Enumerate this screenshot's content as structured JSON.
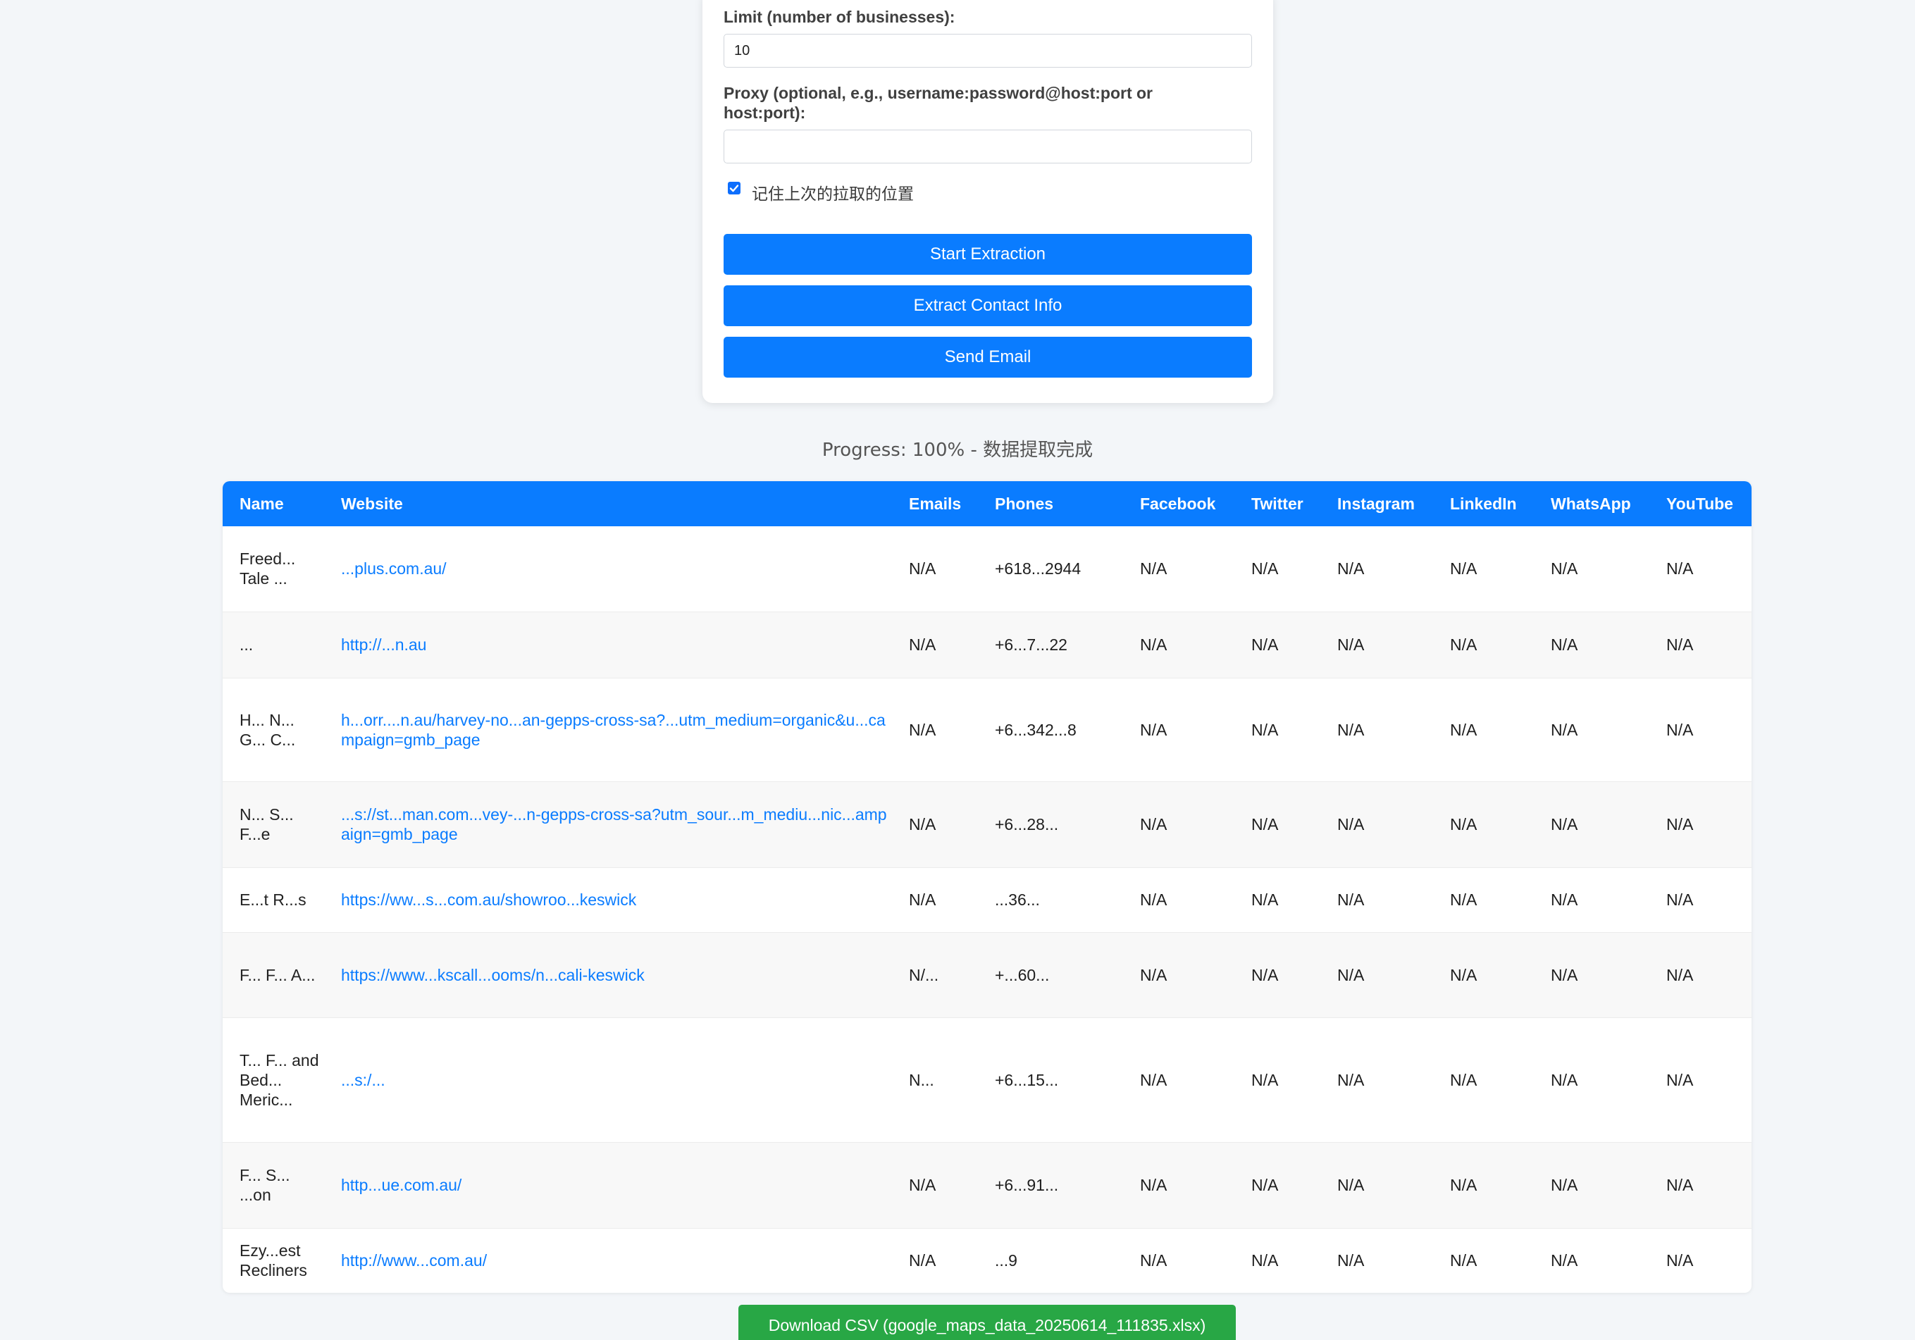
{
  "form": {
    "limit_label": "Limit (number of businesses):",
    "limit_value": "10",
    "proxy_label": "Proxy (optional, e.g., username:password@host:port or host:port):",
    "proxy_value": "",
    "remember_checked": true,
    "remember_label": "记住上次的拉取的位置",
    "start_button": "Start Extraction",
    "extract_button": "Extract Contact Info",
    "email_button": "Send Email"
  },
  "progress": {
    "text": "Progress: 100% - 数据提取完成",
    "percent": 100
  },
  "table": {
    "headers": [
      "Name",
      "Website",
      "Emails",
      "Phones",
      "Facebook",
      "Twitter",
      "Instagram",
      "LinkedIn",
      "WhatsApp",
      "YouTube"
    ],
    "rows": [
      {
        "name": "Freed... Tale ...",
        "website": "...plus.com.au/",
        "emails": "N/A",
        "phones": "+618...2944",
        "facebook": "N/A",
        "twitter": "N/A",
        "instagram": "N/A",
        "linkedin": "N/A",
        "whatsapp": "N/A",
        "youtube": "N/A"
      },
      {
        "name": "...",
        "website": "http://...n.au",
        "emails": "N/A",
        "phones": "+6...7...22",
        "facebook": "N/A",
        "twitter": "N/A",
        "instagram": "N/A",
        "linkedin": "N/A",
        "whatsapp": "N/A",
        "youtube": "N/A"
      },
      {
        "name": "H... N... G... C...",
        "website": "h...orr....n.au/harvey-no...an-gepps-cross-sa?...utm_medium=organic&u...campaign=gmb_page",
        "emails": "N/A",
        "phones": "+6...342...8",
        "facebook": "N/A",
        "twitter": "N/A",
        "instagram": "N/A",
        "linkedin": "N/A",
        "whatsapp": "N/A",
        "youtube": "N/A"
      },
      {
        "name": "N... S... F...e",
        "website": "...s://st...man.com...vey-...n-gepps-cross-sa?utm_sour...m_mediu...nic...ampaign=gmb_page",
        "emails": "N/A",
        "phones": "+6...28...",
        "facebook": "N/A",
        "twitter": "N/A",
        "instagram": "N/A",
        "linkedin": "N/A",
        "whatsapp": "N/A",
        "youtube": "N/A"
      },
      {
        "name": "E...t R...s",
        "website": "https://ww...s...com.au/showroo...keswick",
        "emails": "N/A",
        "phones": "...36...",
        "facebook": "N/A",
        "twitter": "N/A",
        "instagram": "N/A",
        "linkedin": "N/A",
        "whatsapp": "N/A",
        "youtube": "N/A"
      },
      {
        "name": "F... F... A...",
        "website": "https://www...kscall...ooms/n...cali-keswick",
        "emails": "N/...",
        "phones": "+...60...",
        "facebook": "N/A",
        "twitter": "N/A",
        "instagram": "N/A",
        "linkedin": "N/A",
        "whatsapp": "N/A",
        "youtube": "N/A"
      },
      {
        "name": "T... F... and Bed... Meric...",
        "website": "...s:/...",
        "emails": "N...",
        "phones": "+6...15...",
        "facebook": "N/A",
        "twitter": "N/A",
        "instagram": "N/A",
        "linkedin": "N/A",
        "whatsapp": "N/A",
        "youtube": "N/A"
      },
      {
        "name": "F... S... ...on",
        "website": "http...ue.com.au/",
        "emails": "N/A",
        "phones": "+6...91...",
        "facebook": "N/A",
        "twitter": "N/A",
        "instagram": "N/A",
        "linkedin": "N/A",
        "whatsapp": "N/A",
        "youtube": "N/A"
      },
      {
        "name": "Ezy...est Recliners",
        "website": "http://www...com.au/",
        "emails": "N/A",
        "phones": "...9",
        "facebook": "N/A",
        "twitter": "N/A",
        "instagram": "N/A",
        "linkedin": "N/A",
        "whatsapp": "N/A",
        "youtube": "N/A"
      }
    ]
  },
  "download": {
    "label": "Download CSV (google_maps_data_20250614_111835.xlsx)"
  },
  "colors": {
    "primary": "#0a7cff",
    "success": "#28a745",
    "background": "#f3f6f9"
  }
}
